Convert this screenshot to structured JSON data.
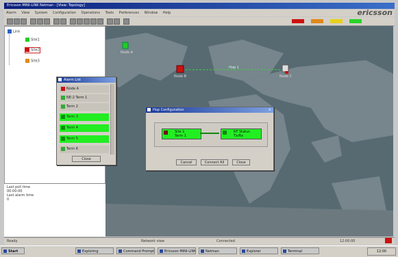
{
  "window": {
    "title": "Ericsson MINI-LINK Netman - [View: Topology]"
  },
  "menu": [
    "Alarm",
    "View",
    "System",
    "Configuration",
    "Operations",
    "Tools",
    "Preferences",
    "Window",
    "Help"
  ],
  "logo": "ericsson",
  "tree": {
    "root": "Link",
    "nodes": [
      {
        "label": "Site1"
      },
      {
        "label": "Site2"
      },
      {
        "label": "Site3"
      }
    ]
  },
  "properties": {
    "rows": [
      {
        "key": "Last poll time",
        "value": "00:00:00"
      },
      {
        "key": "Last alarm time",
        "value": "0"
      }
    ]
  },
  "map": {
    "nodes": [
      {
        "label": "Node A"
      },
      {
        "label": "Node B"
      },
      {
        "label": "Node C"
      }
    ],
    "link_label": "Hop 1"
  },
  "alarm_list": {
    "title": "Alarm List",
    "items": [
      {
        "label": "Node A",
        "status": "#cc1111"
      },
      {
        "label": "NE-2 Term 1",
        "status": "#33aa33"
      },
      {
        "label": "Term 2",
        "status": "#33aa33"
      },
      {
        "label": "Term 3",
        "status": "#22ee22"
      },
      {
        "label": "Term 4",
        "status": "#22ee22"
      },
      {
        "label": "Term 5",
        "status": "#22ee22"
      },
      {
        "label": "Term 6",
        "status": "#33aa33"
      }
    ],
    "button": "Close"
  },
  "dialog": {
    "title": "Hop Configuration",
    "left_label": "Site 1",
    "left_sub": "Term 1",
    "right_label": "RF Status",
    "right_sub": "Tx/Rx",
    "buttons": {
      "cancel": "Cancel",
      "apply": "Connect All",
      "close": "Close"
    }
  },
  "status": {
    "left": "Ready",
    "mid": "Network view",
    "mid2": "Connected",
    "right": "12:00:00"
  },
  "taskbar": {
    "start": "Start",
    "tasks": [
      "Exploring",
      "Command Prompt",
      "Ericsson MINI-LINK",
      "Netman",
      "Explorer",
      "Terminal"
    ],
    "clock": "12:00"
  },
  "colors": {
    "map_water": "#576a72",
    "map_land": "#77858c",
    "alarm_red": "#cc1111",
    "ok_green": "#22ee22"
  }
}
